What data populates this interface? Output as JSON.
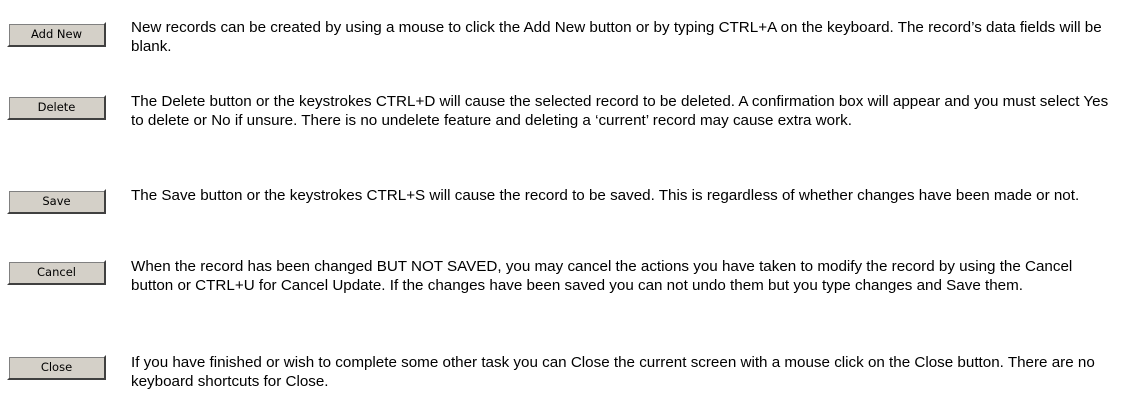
{
  "items": [
    {
      "button_label": "Add New",
      "description": "New records can be created by using a mouse to click the Add New button or by typing CTRL+A on the keyboard. The record’s data fields will be blank."
    },
    {
      "button_label": "Delete",
      "description": "The Delete button or the keystrokes CTRL+D will cause the selected record to be deleted. A confirmation box will appear and you must select Yes to delete or No if unsure.  There is no undelete feature and deleting a ‘current’ record may cause extra work."
    },
    {
      "button_label": "Save",
      "description": "The Save button or the keystrokes CTRL+S will cause the record to be saved. This is regardless of whether changes have been made or not."
    },
    {
      "button_label": "Cancel",
      "description": "When the record has been changed BUT NOT SAVED, you may cancel the actions you have taken to modify the record by using the Cancel button or CTRL+U for Cancel Update. If the changes have been saved you can not undo them but you type changes and Save them."
    },
    {
      "button_label": "Close",
      "description": "If you have finished or wish to complete some other task you can Close the current screen with a mouse click on the Close button. There are no keyboard shortcuts for Close."
    }
  ]
}
